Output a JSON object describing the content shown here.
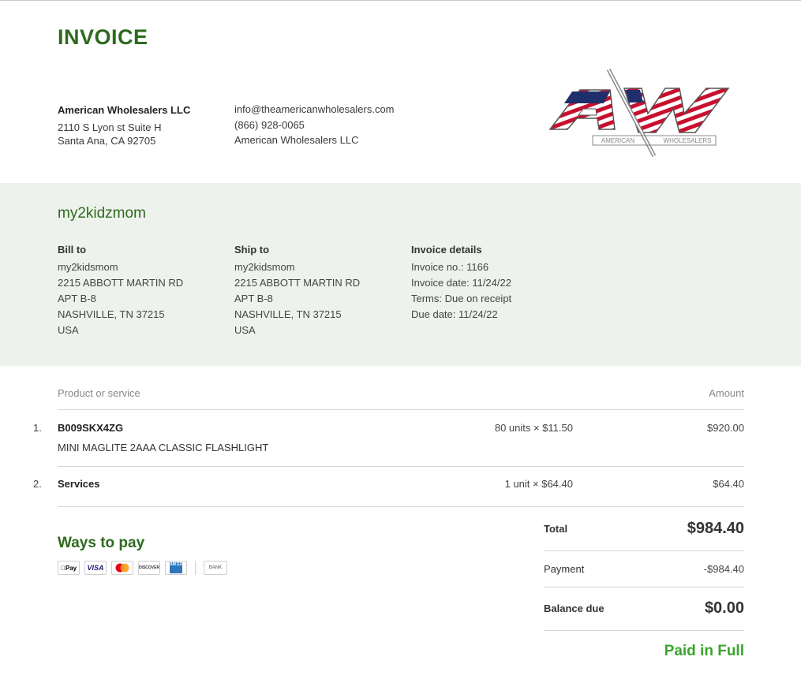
{
  "title": "INVOICE",
  "company": {
    "name": "American Wholesalers LLC",
    "address1": "2110 S Lyon st Suite H",
    "address2": "Santa Ana, CA 92705",
    "email": "info@theamericanwholesalers.com",
    "phone": "(866) 928-0065",
    "legal_name": "American Wholesalers LLC"
  },
  "logo": {
    "letters": "AW",
    "tagline_left": "AMERICAN",
    "tagline_right": "WHOLESALERS"
  },
  "customer_name": "my2kidzmom",
  "bill_to": {
    "heading": "Bill to",
    "lines": [
      "my2kidsmom",
      "2215 ABBOTT MARTIN RD",
      "APT B-8",
      "NASHVILLE, TN 37215",
      "USA"
    ]
  },
  "ship_to": {
    "heading": "Ship to",
    "lines": [
      "my2kidsmom",
      "2215 ABBOTT MARTIN RD",
      "APT B-8",
      "NASHVILLE, TN 37215",
      "USA"
    ]
  },
  "invoice_details": {
    "heading": "Invoice details",
    "lines": [
      "Invoice no.: 1166",
      "Invoice date: 11/24/22",
      "Terms: Due on receipt",
      "Due date: 11/24/22"
    ]
  },
  "table": {
    "col_product": "Product or service",
    "col_amount": "Amount",
    "rows": [
      {
        "index": "1.",
        "sku": "B009SKX4ZG",
        "description": "MINI MAGLITE 2AAA CLASSIC FLASHLIGHT",
        "qty": "80 units × $11.50",
        "amount": "$920.00"
      },
      {
        "index": "2.",
        "sku": "Services",
        "description": "",
        "qty": "1 unit × $64.40",
        "amount": "$64.40"
      }
    ]
  },
  "ways_to_pay": {
    "heading": "Ways to pay",
    "icons": [
      "apple-pay",
      "visa",
      "mastercard",
      "discover",
      "amex",
      "bank"
    ],
    "labels": {
      "apple_pay": "Pay",
      "visa": "VISA",
      "discover": "DISCOVER",
      "amex": "AM EX",
      "bank": "BANK"
    }
  },
  "totals": {
    "total_label": "Total",
    "total_value": "$984.40",
    "payment_label": "Payment",
    "payment_value": "-$984.40",
    "balance_label": "Balance due",
    "balance_value": "$0.00",
    "status": "Paid in Full"
  },
  "colors": {
    "brand_green": "#2d6a1e",
    "paid_green": "#3aa52c",
    "band_bg": "#eef2ec",
    "flag_red": "#c8102e",
    "flag_blue": "#1f2f6b"
  }
}
